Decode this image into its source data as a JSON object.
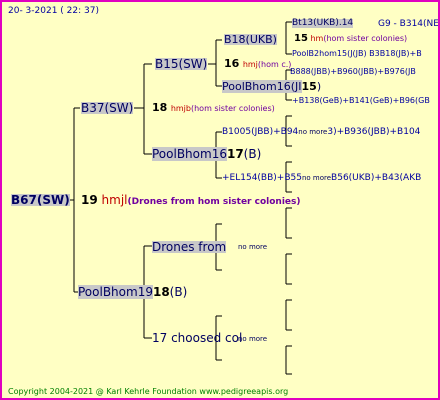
{
  "header": {
    "date": "20-  3-2021 ( 22: 37)",
    "code": "G9 - B314(NE)"
  },
  "queen": {
    "name": "B67(SW)",
    "gen_number": "19",
    "hmjl": "hmjl",
    "note": "(Drones from hom sister colonies)"
  },
  "sire": {
    "name": "B37(SW)",
    "gen_number": "18",
    "hmjb": "hmjb",
    "note": "(hom sister colonies)"
  },
  "dam_side": {
    "name": "PoolBhom19",
    "gen_number": "18",
    "suffix": "(B)"
  },
  "ss": {
    "name": "B15(SW)",
    "gen_number": "16",
    "hmj": "hmj",
    "note": "(hom c.)"
  },
  "sd": {
    "name": "PoolBhom16",
    "gen_number": "17",
    "suffix": "(B)"
  },
  "sss": {
    "name": "B18(UKB)"
  },
  "ssd": {
    "name": "PoolBhom16(JI",
    "gen_number": "15",
    "suffix": ")"
  },
  "ssss": {
    "name": "Bt13(UKB).14"
  },
  "sssd_num": "15",
  "sssd_hm": "hm",
  "sssd_note": "(hom sister colonies)",
  "sssd_line": "PoolB2hom15(J(JB) B3",
  "sssd_extra": "B18(JB)+B",
  "ssd_line1": "B888(JBB)+B960(JBB)+B976(JB",
  "ssd_line2": "+B138(GeB)+B141(GeB)+B96(GB",
  "sd_line1_a": "B1005(JBB)+B94",
  "sd_line1_b": "no more",
  "sd_line1_c": "3)+B936(JBB)+B104",
  "sd_line2_a": "+EL154(BB)+B55",
  "sd_line2_b": "no more",
  "sd_line2_c": "B56(UKB)+B43(AKB",
  "drones_label": "Drones from",
  "no_more_1": "no more",
  "chosen_label": "17 choosed col",
  "no_more_2": "no more",
  "footer": "Copyright 2004-2021 @ Karl Kehrle Foundation    www.pedigreeapis.org"
}
